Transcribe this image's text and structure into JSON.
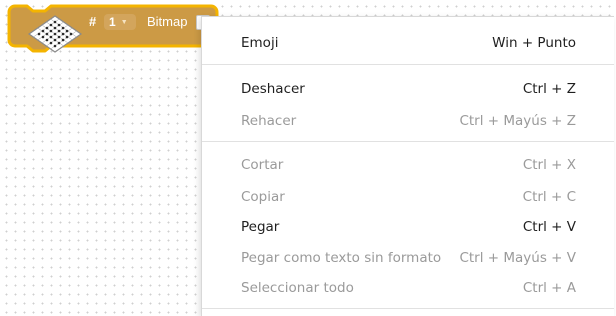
{
  "block": {
    "hash": "#",
    "number": "1",
    "label": "Bitmap",
    "colors": {
      "fill": "#cc9a45",
      "border": "#f4b400",
      "field": "#d3a55c"
    }
  },
  "menu": {
    "items": [
      {
        "label": "Emoji",
        "shortcut": "Win + Punto",
        "enabled": true
      },
      {
        "label": "Deshacer",
        "shortcut": "Ctrl + Z",
        "enabled": true
      },
      {
        "label": "Rehacer",
        "shortcut": "Ctrl + Mayús + Z",
        "enabled": false
      },
      {
        "label": "Cortar",
        "shortcut": "Ctrl + X",
        "enabled": false
      },
      {
        "label": "Copiar",
        "shortcut": "Ctrl + C",
        "enabled": false
      },
      {
        "label": "Pegar",
        "shortcut": "Ctrl + V",
        "enabled": true
      },
      {
        "label": "Pegar como texto sin formato",
        "shortcut": "Ctrl + Mayús + V",
        "enabled": false
      },
      {
        "label": "Seleccionar todo",
        "shortcut": "Ctrl + A",
        "enabled": false
      }
    ]
  }
}
